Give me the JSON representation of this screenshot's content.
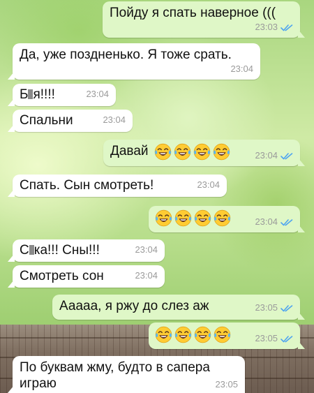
{
  "messages": [
    {
      "dir": "out",
      "text": "Пойду я спать наверное (((",
      "time": "23:03",
      "read": true
    },
    {
      "dir": "in",
      "text": "Да, уже поздненько. Я тоже срать.",
      "time": "23:04"
    },
    {
      "dir": "in",
      "text_before": "Б",
      "text_after": "я!!!!",
      "censored": true,
      "time": "23:04"
    },
    {
      "dir": "in",
      "text": "Спальни",
      "time": "23:04"
    },
    {
      "dir": "out",
      "text": "Давай",
      "emoji": [
        "face-with-tears-of-joy-icon",
        "face-with-tears-of-joy-icon",
        "face-with-tears-of-joy-icon",
        "face-with-tears-of-joy-icon"
      ],
      "time": "23:04",
      "read": true
    },
    {
      "dir": "in",
      "text": "Спать. Сын смотреть!",
      "time": "23:04"
    },
    {
      "dir": "out",
      "emoji": [
        "face-with-tears-of-joy-icon",
        "face-with-tears-of-joy-icon",
        "face-with-tears-of-joy-icon",
        "face-with-tears-of-joy-icon"
      ],
      "time": "23:04",
      "read": true
    },
    {
      "dir": "in",
      "text_before": "С",
      "text_after": "ка!!! Сны!!!",
      "censored": true,
      "time": "23:04"
    },
    {
      "dir": "in",
      "text": "Смотреть сон",
      "time": "23:04"
    },
    {
      "dir": "out",
      "text": "Ааааа, я ржу до слез аж",
      "time": "23:05",
      "read": true
    },
    {
      "dir": "out",
      "emoji": [
        "face-with-tears-of-joy-icon",
        "face-with-tears-of-joy-icon",
        "face-with-tears-of-joy-icon",
        "face-with-tears-of-joy-icon"
      ],
      "time": "23:05",
      "read": true
    },
    {
      "dir": "in",
      "text_line1": "По буквам жму, будто в сапера",
      "text_line2": "играю",
      "time": "23:05"
    }
  ],
  "colors": {
    "outgoing_bubble": "#dff7c7",
    "incoming_bubble": "#ffffff",
    "read_ticks": "#4ea4f0",
    "timestamp": "#9a9a9a"
  }
}
